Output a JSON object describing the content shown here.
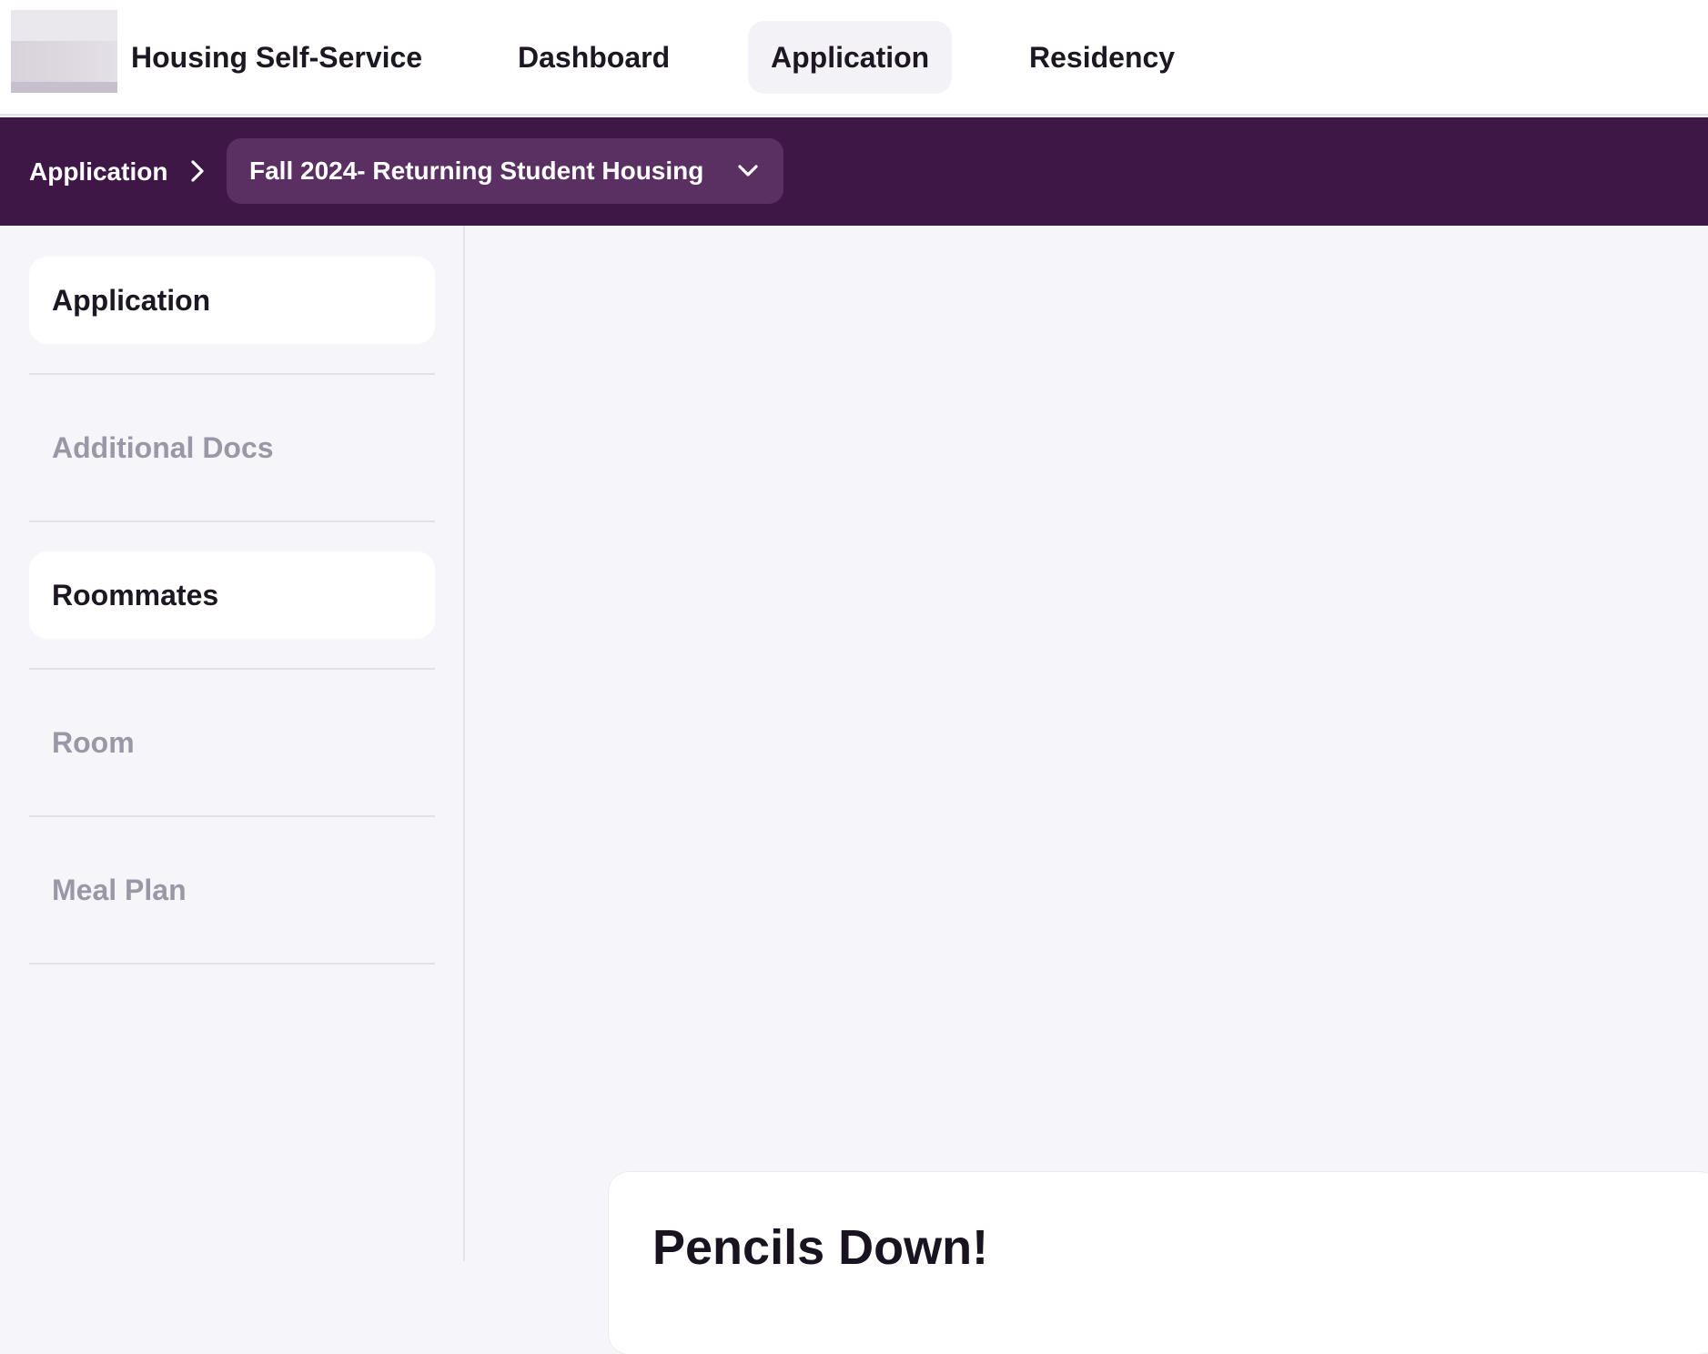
{
  "header": {
    "app_title": "Housing Self-Service",
    "tabs": [
      {
        "label": "Dashboard",
        "active": false
      },
      {
        "label": "Application",
        "active": true
      },
      {
        "label": "Residency",
        "active": false
      }
    ]
  },
  "breadcrumb": {
    "root": "Application",
    "selected_term": "Fall 2024- Returning Student Housing",
    "separator_icon": "chevron-right-icon",
    "dropdown_icon": "chevron-down-icon"
  },
  "sidebar": {
    "items": [
      {
        "label": "Application",
        "enabled": true
      },
      {
        "label": "Additional Docs",
        "enabled": false
      },
      {
        "label": "Roommates",
        "enabled": true
      },
      {
        "label": "Room",
        "enabled": false
      },
      {
        "label": "Meal Plan",
        "enabled": false
      }
    ]
  },
  "main": {
    "card_title": "Pencils Down!"
  },
  "colors": {
    "brand_purple": "#3f1746",
    "dropdown_bg": "#5a2f62",
    "page_bg": "#f6f5f9",
    "disabled_text": "#9a98a6"
  }
}
